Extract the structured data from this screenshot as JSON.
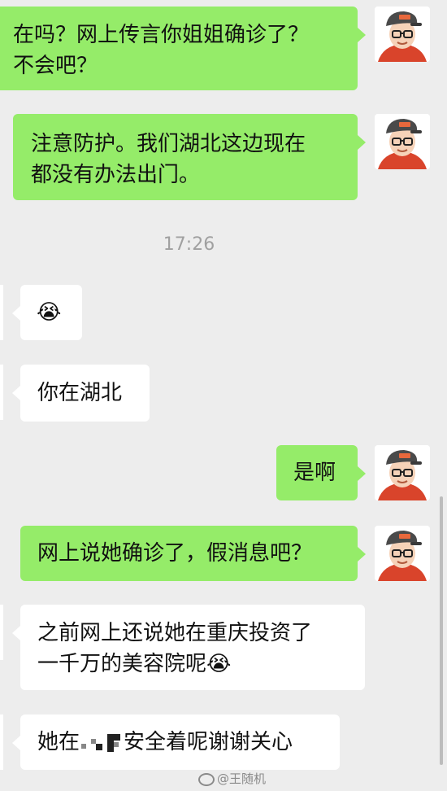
{
  "chat": {
    "messages": [
      {
        "side": "me",
        "lines": [
          "在吗？网上传言你姐姐确诊了？",
          "不会吧？"
        ]
      },
      {
        "side": "me",
        "lines": [
          "注意防护。我们湖北这边现在",
          "都没有办法出门。"
        ]
      },
      {
        "side": "other",
        "emoji": "😭"
      },
      {
        "side": "other",
        "lines": [
          "你在湖北"
        ]
      },
      {
        "side": "me",
        "lines": [
          "是啊"
        ]
      },
      {
        "side": "me",
        "lines": [
          "网上说她确诊了，假消息吧？"
        ]
      },
      {
        "side": "other",
        "lines": [
          "之前网上还说她在重庆投资了",
          "一千万的美容院呢"
        ],
        "trailing_emoji": "😭"
      },
      {
        "side": "other",
        "prefix": "她在",
        "suffix": "安全着呢谢谢关心"
      }
    ],
    "timestamp": "17:26"
  },
  "watermark": "@王随机",
  "colors": {
    "me_bubble": "#95ec69",
    "other_bubble": "#ffffff",
    "background": "#ededed"
  },
  "icons": {
    "avatar": "cartoon-avatar-icon"
  }
}
